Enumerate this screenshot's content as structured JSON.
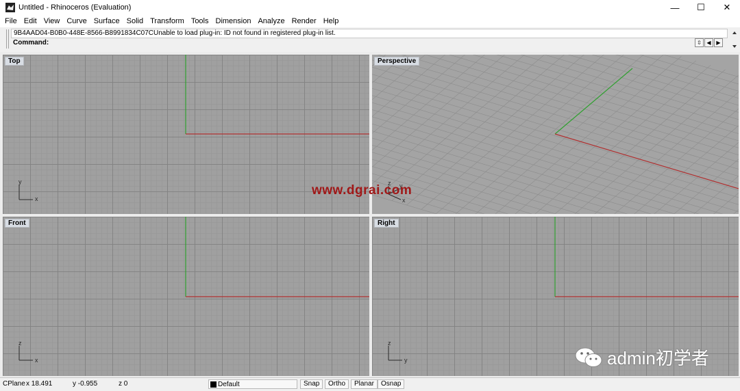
{
  "window": {
    "title": "Untitled - Rhinoceros (Evaluation)",
    "controls": {
      "minimize": "—",
      "maximize": "☐",
      "close": "✕"
    }
  },
  "menu": [
    "File",
    "Edit",
    "View",
    "Curve",
    "Surface",
    "Solid",
    "Transform",
    "Tools",
    "Dimension",
    "Analyze",
    "Render",
    "Help"
  ],
  "command": {
    "history_text": "9B4AAD04-B0B0-448E-8566-B8991834C07CUnable to load plug-in: ID not found in registered plug-in list.",
    "prompt": "Command:",
    "buttons": [
      "⇳",
      "◀",
      "▶"
    ]
  },
  "viewports": {
    "top": {
      "label": "Top",
      "axis_a": "y",
      "axis_b": "x"
    },
    "perspective": {
      "label": "Perspective",
      "axis_a": "z",
      "axis_b": "y",
      "axis_c": "x"
    },
    "front": {
      "label": "Front",
      "axis_a": "z",
      "axis_b": "x"
    },
    "right": {
      "label": "Right",
      "axis_a": "z",
      "axis_b": "y"
    }
  },
  "colors": {
    "x_axis": "#b03030",
    "y_axis": "#30a030",
    "viewport_bg": "#a0a0a0"
  },
  "watermark": "www.dgrai.com",
  "brand": "admin初学者",
  "status": {
    "cplane": "CPlane",
    "x": "x 18.491",
    "y": "y -0.955",
    "z": "z 0",
    "layer": "Default",
    "snap": "Snap",
    "ortho": "Ortho",
    "planar": "Planar",
    "osnap": "Osnap"
  }
}
